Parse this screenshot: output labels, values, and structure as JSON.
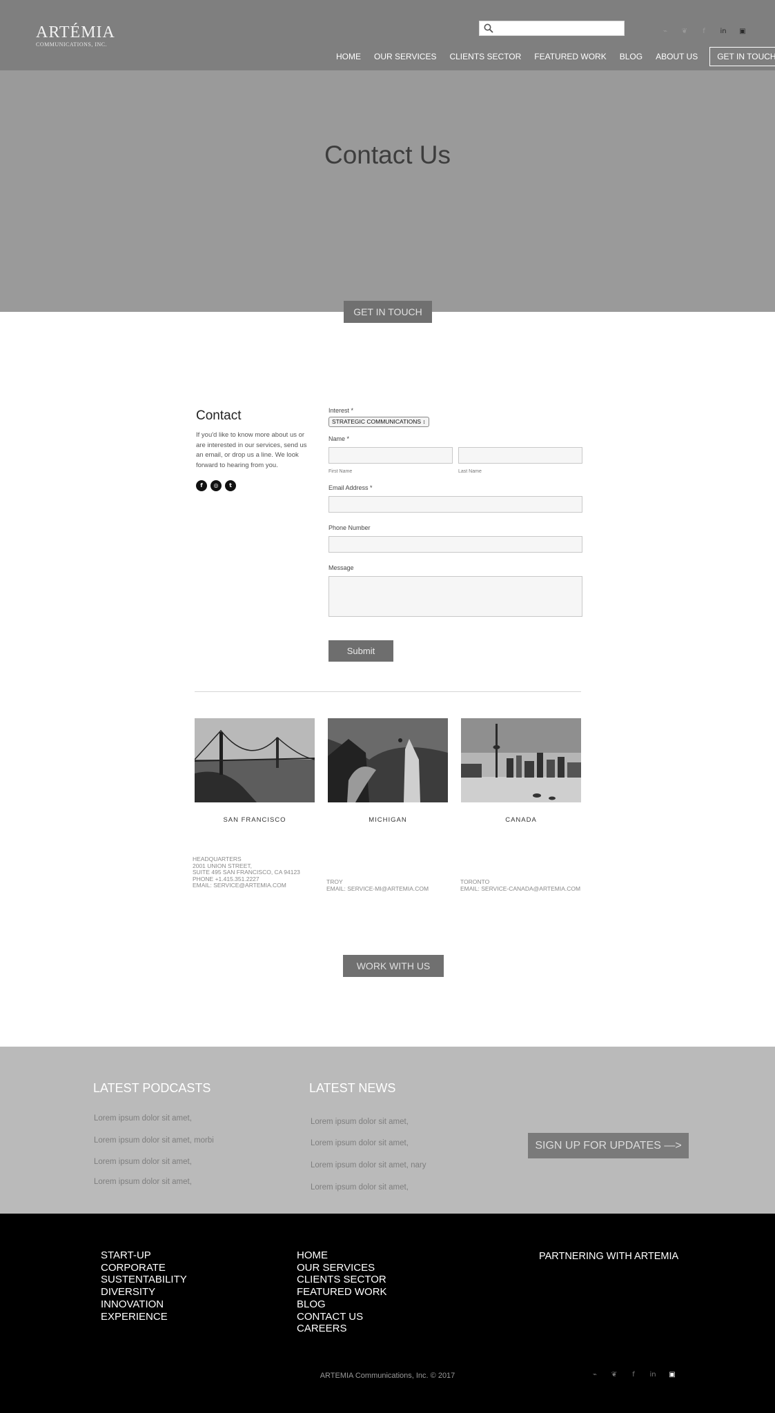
{
  "header": {
    "logo_main": "ARTÉMIA",
    "logo_sub": "COMMUNICATIONS, INC.",
    "search_placeholder": "",
    "social_icons": [
      "rss-icon",
      "twitter-icon",
      "facebook-icon",
      "linkedin-icon",
      "instagram-icon"
    ],
    "social_glyphs": [
      "⌁",
      "❦",
      "f",
      "in",
      "▣"
    ],
    "nav": {
      "home": "HOME",
      "services": "OUR SERVICES",
      "clients": "CLIENTS SECTOR",
      "featured": "FEATURED WORK",
      "blog": "BLOG",
      "about": "ABOUT US",
      "cta": "GET IN TOUCH"
    }
  },
  "hero": {
    "title": "Contact Us",
    "button": "GET IN TOUCH"
  },
  "contact": {
    "heading": "Contact",
    "text": "If you'd like to know more about us or are interested in our services, send us an email, or drop us a line. We look forward to hearing from you.",
    "social": [
      "f",
      "◎",
      "t"
    ],
    "form": {
      "interest_label": "Interest *",
      "interest_value": "STRATEGIC COMMUNICATIONS ↕",
      "name_label": "Name *",
      "first_name_label": "First Name",
      "last_name_label": "Last Name",
      "email_label": "Email Address *",
      "phone_label": "Phone Number",
      "message_label": "Message",
      "submit": "Submit"
    }
  },
  "locations": [
    {
      "name": "SAN FRANCISCO",
      "address": [
        "HEADQUARTERS",
        "2001 UNION STREET,",
        "SUITE 495 SAN FRANCISCO, CA 94123",
        "PHONE +1.415.351.2227",
        "EMAIL: SERVICE@ARTEMIA.COM"
      ]
    },
    {
      "name": "MICHIGAN",
      "address": [
        "TROY",
        "EMAIL: SERVICE-MI@ARTEMIA.COM"
      ]
    },
    {
      "name": "CANADA",
      "address": [
        "TORONTO",
        "EMAIL: SERVICE-CANADA@ARTEMIA.COM"
      ]
    }
  ],
  "work_button": "WORK WITH US",
  "news_band": {
    "podcasts_title": "LATEST PODCASTS",
    "podcasts": [
      "Lorem ipsum dolor sit amet,",
      "Lorem ipsum dolor sit amet, morbi",
      "Lorem ipsum dolor sit amet,",
      "Lorem ipsum dolor sit amet,"
    ],
    "news_title": "LATEST NEWS",
    "news": [
      "Lorem ipsum dolor sit amet,",
      "Lorem ipsum dolor sit amet,",
      "Lorem ipsum dolor sit amet, nary",
      "Lorem ipsum dolor sit amet,"
    ],
    "signup": "SIGN UP FOR UPDATES  —>"
  },
  "footer": {
    "col1": [
      "START-UP",
      "CORPORATE",
      "SUSTENTABILITY",
      "DIVERSITY",
      "INNOVATION",
      "EXPERIENCE"
    ],
    "col2": [
      "HOME",
      "OUR SERVICES",
      "CLIENTS SECTOR",
      "FEATURED WORK",
      "BLOG",
      "CONTACT US",
      "CAREERS"
    ],
    "partner": "PARTNERING WITH ARTEMIA",
    "copyright": "ARTEMIA Communications, Inc. © 2017",
    "social_glyphs": [
      "⌁",
      "❦",
      "f",
      "in",
      "▣"
    ]
  }
}
